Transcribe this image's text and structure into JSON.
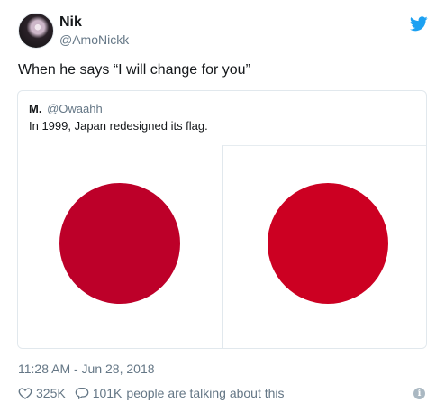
{
  "author": {
    "name": "Nik",
    "handle": "@AmoNickk"
  },
  "tweet": {
    "text": "When he says “I will change for you”",
    "timestamp": "11:28 AM - Jun 28, 2018"
  },
  "quoted": {
    "name": "M.",
    "handle": "@Owaahh",
    "text": "In 1999, Japan redesigned its flag.",
    "colors": {
      "left_disc": "#bd0029",
      "right_disc": "#cc0022"
    }
  },
  "stats": {
    "likes": "325K",
    "replies": "101K",
    "talking_text": "people are talking about this"
  },
  "icons": {
    "brand": "twitter-bird-icon",
    "like": "heart-icon",
    "reply": "speech-bubble-icon",
    "info": "info-icon"
  },
  "theme": {
    "brand_color": "#1da1f2",
    "secondary_text": "#657786"
  }
}
